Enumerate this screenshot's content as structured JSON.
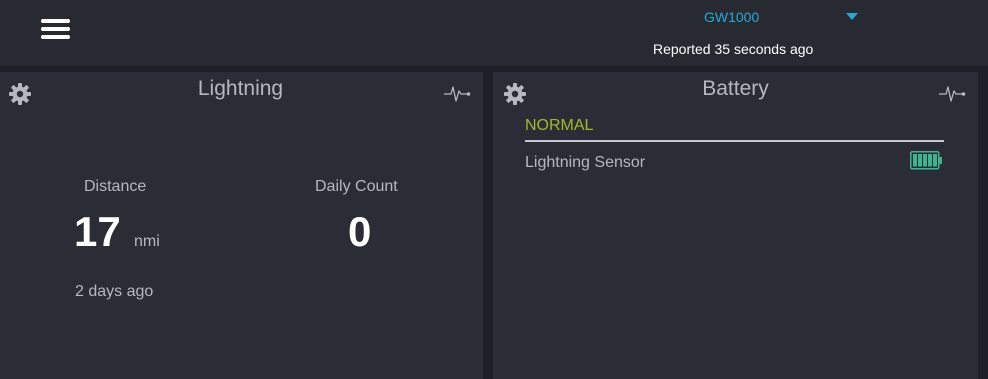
{
  "header": {
    "device_name": "GW1000",
    "reported": "Reported 35 seconds ago"
  },
  "lightning_panel": {
    "title": "Lightning",
    "distance_label": "Distance",
    "distance_value": "17",
    "distance_unit": "nmi",
    "distance_time": "2 days ago",
    "count_label": "Daily Count",
    "count_value": "0"
  },
  "battery_panel": {
    "title": "Battery",
    "status": "NORMAL",
    "sensor_label": "Lightning Sensor"
  },
  "colors": {
    "accent": "#27a9d6",
    "status_normal": "#9fba2c",
    "battery_fill": "#3fb391"
  },
  "icons": {
    "menu": "hamburger-icon",
    "dropdown": "caret-down-icon",
    "settings": "gear-icon",
    "chart": "pulse-icon",
    "battery": "battery-full-icon"
  }
}
